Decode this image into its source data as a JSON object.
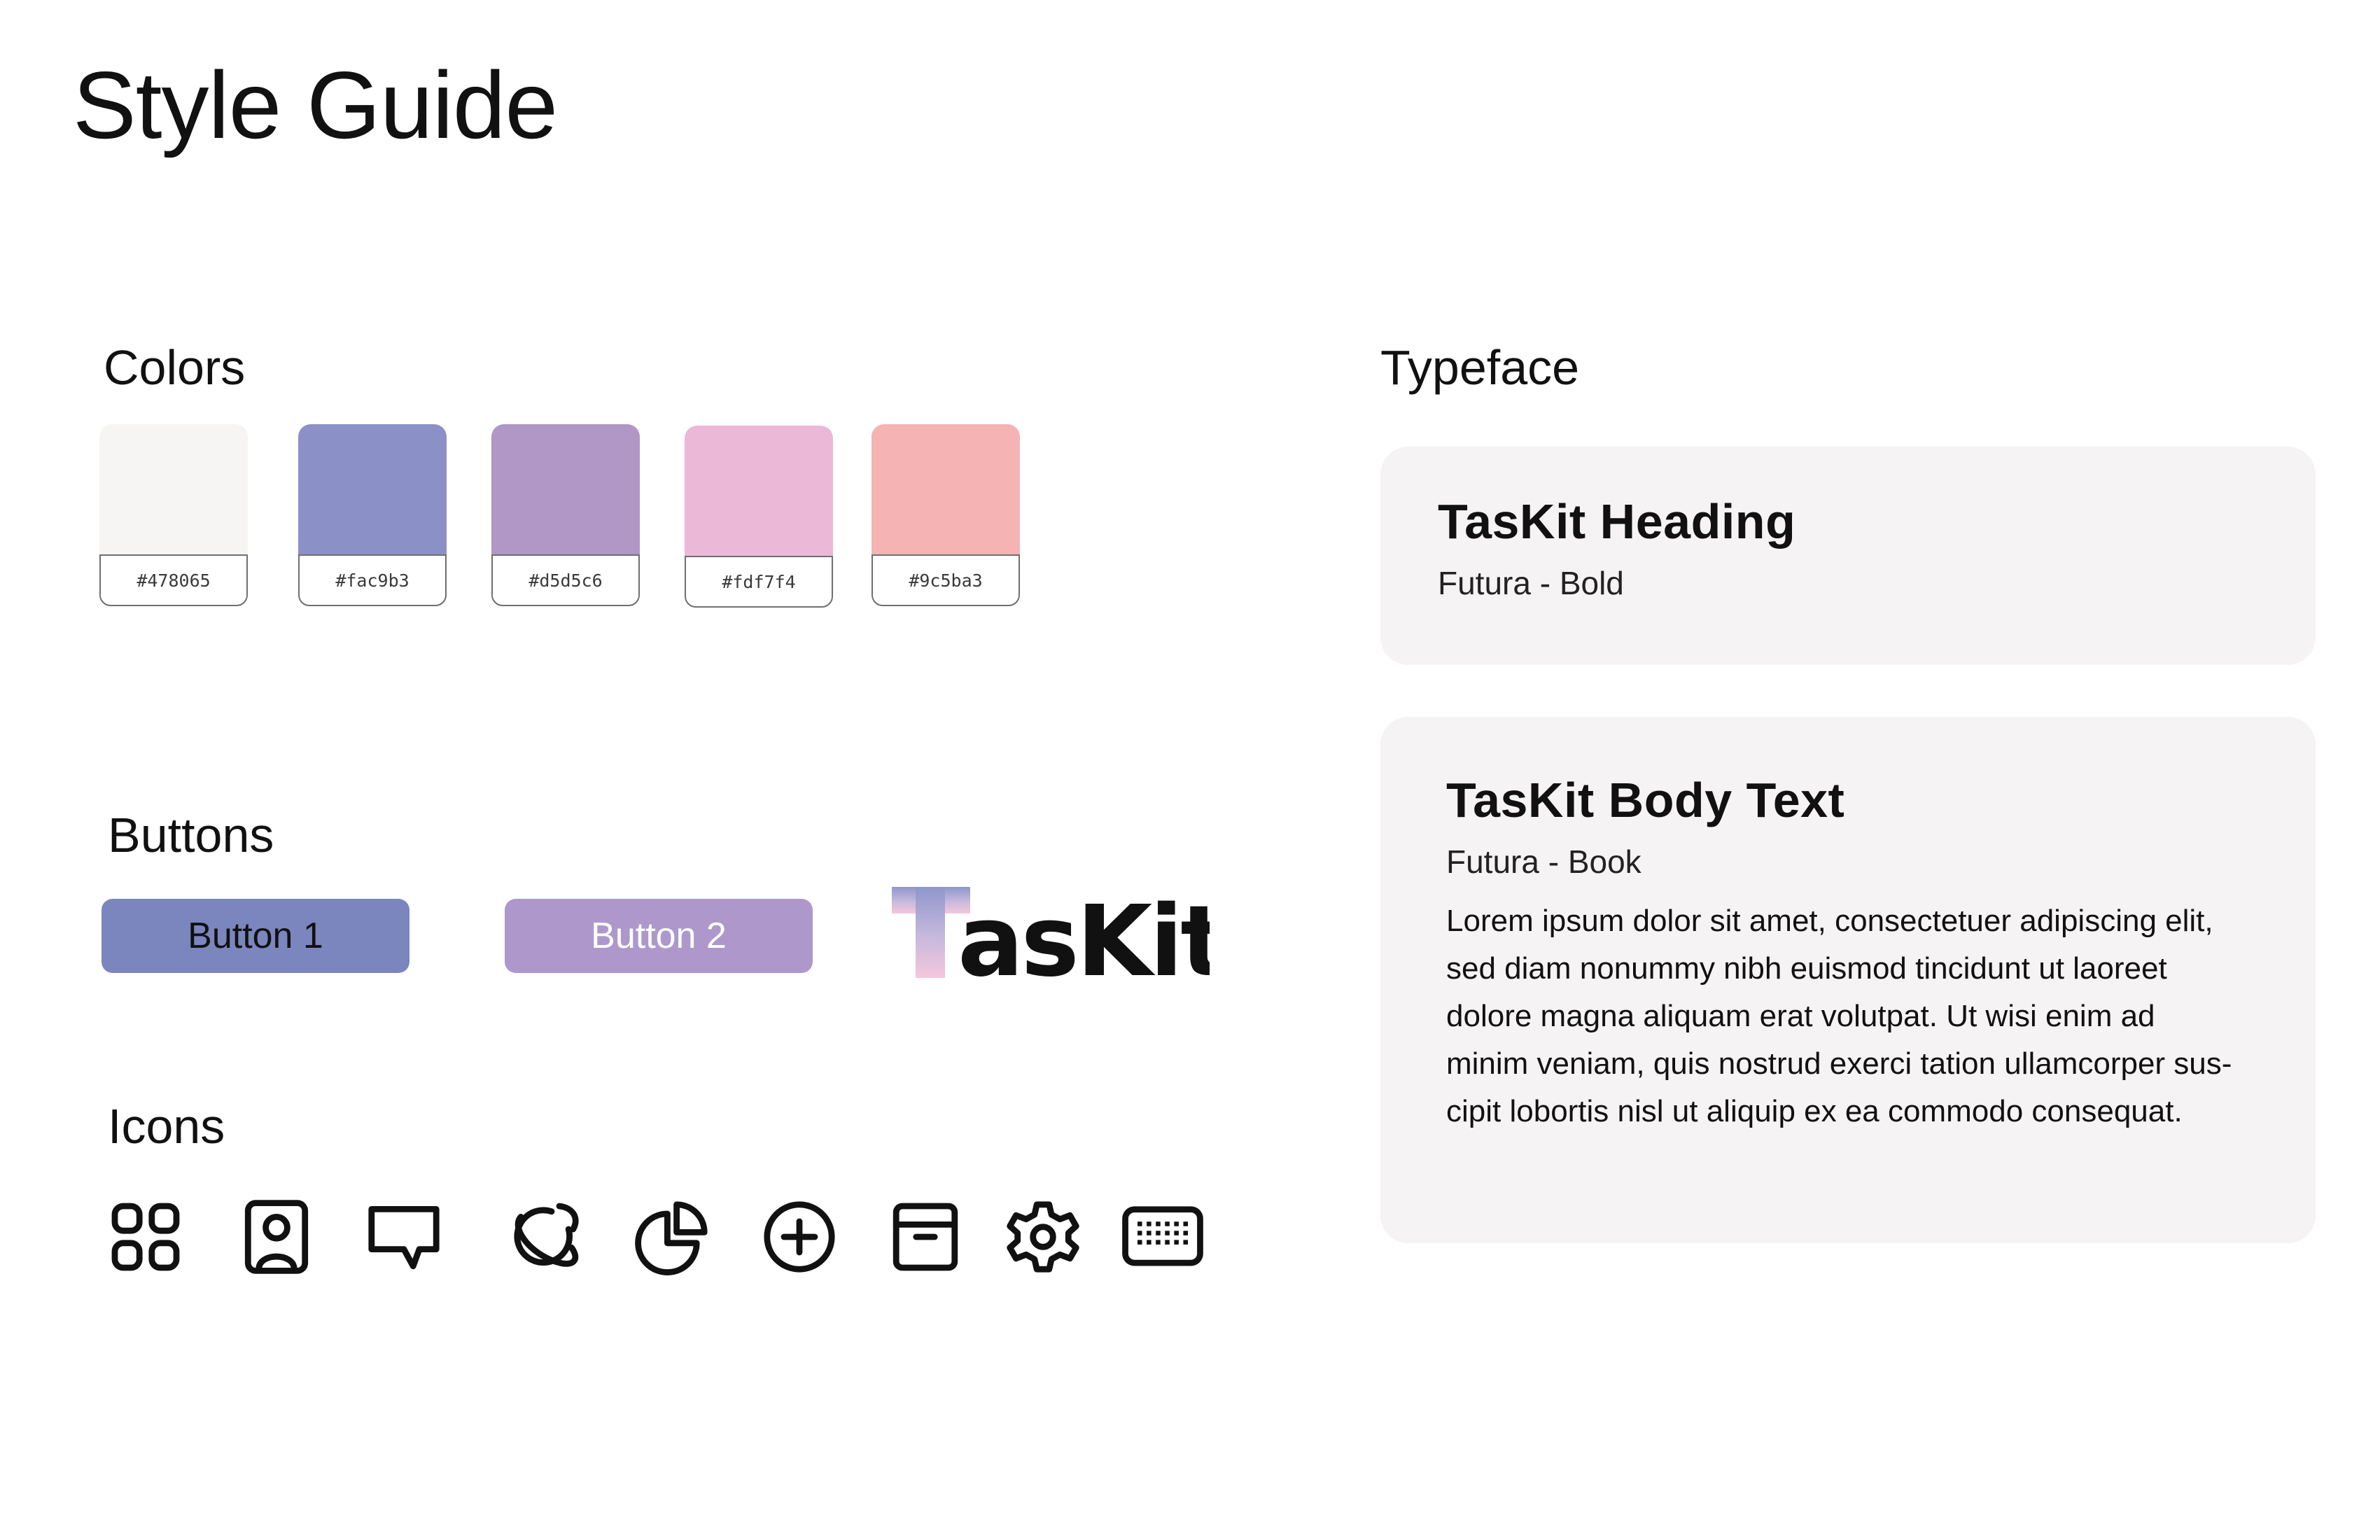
{
  "page": {
    "title": "Style Guide"
  },
  "colors": {
    "title": "Colors",
    "swatches": [
      {
        "hex": "#f7f4f4",
        "label": "#478065"
      },
      {
        "hex": "#8b91c7",
        "label": "#fac9b3"
      },
      {
        "hex": "#b097c6",
        "label": "#d5d5c6"
      },
      {
        "hex": "#ecb8d8",
        "label": "#fdf7f4"
      },
      {
        "hex": "#f5b3b4",
        "label": "#9c5ba3"
      }
    ]
  },
  "buttons": {
    "title": "Buttons",
    "button1": {
      "label": "Button 1",
      "bg": "#7a86bd",
      "text_color": "#111111"
    },
    "button2": {
      "label": "Button 2",
      "bg": "#ae98cb",
      "text_color": "#ffffff"
    },
    "logo": {
      "text": "TasKit"
    }
  },
  "icons": {
    "title": "Icons",
    "items": [
      "grid-icon",
      "profile-card-icon",
      "chat-bubble-icon",
      "planet-icon",
      "pie-chart-icon",
      "add-circle-icon",
      "archive-box-icon",
      "settings-gear-icon",
      "keyboard-icon"
    ]
  },
  "typeface": {
    "title": "Typeface",
    "heading_card": {
      "heading": "TasKit Heading",
      "sub": "Futura - Bold"
    },
    "body_card": {
      "heading": "TasKit Body Text",
      "sub": "Futura - Book",
      "lines": [
        "Lorem ipsum dolor sit amet, consectetuer adipiscing elit,",
        "sed diam nonummy nibh euismod tincidunt ut laoreet",
        "dolore magna aliquam erat volutpat. Ut wisi enim ad",
        "minim veniam, quis nostrud exerci tation ullamcorper sus-",
        "cipit lobortis nisl ut aliquip ex ea commodo consequat."
      ]
    }
  }
}
